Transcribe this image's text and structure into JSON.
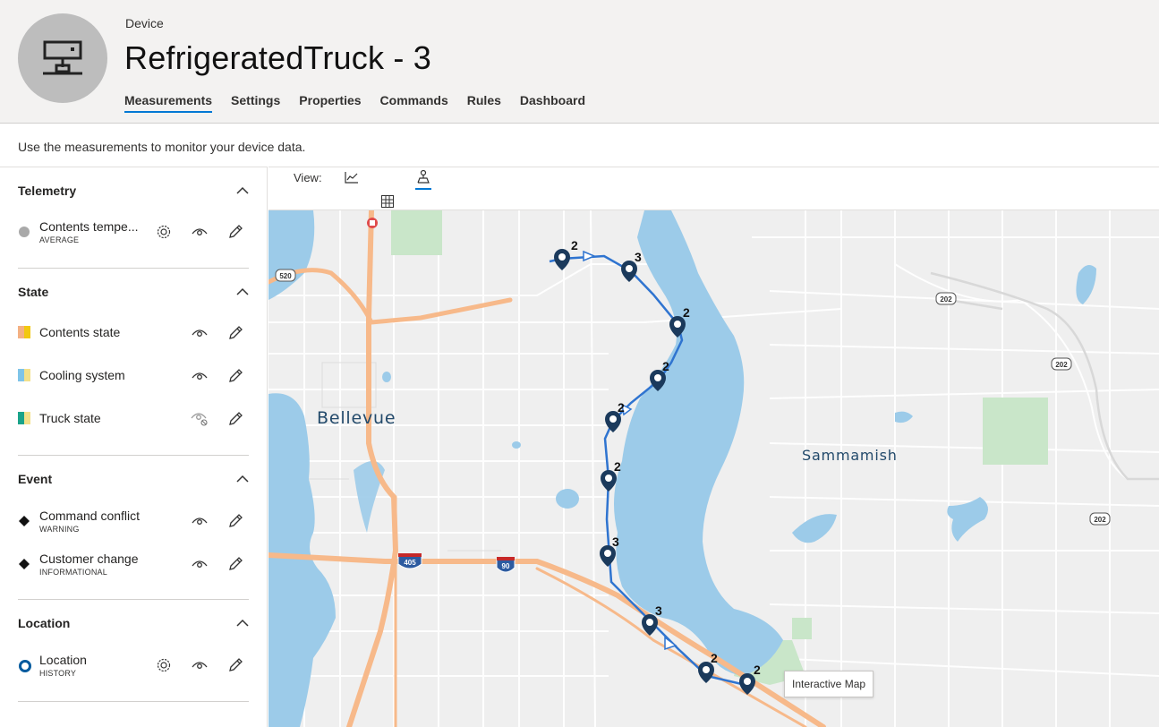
{
  "header": {
    "kicker": "Device",
    "title": "RefrigeratedTruck - 3",
    "avatar_icon": "device-icon",
    "tabs": [
      {
        "label": "Measurements",
        "active": true
      },
      {
        "label": "Settings",
        "active": false
      },
      {
        "label": "Properties",
        "active": false
      },
      {
        "label": "Commands",
        "active": false
      },
      {
        "label": "Rules",
        "active": false
      },
      {
        "label": "Dashboard",
        "active": false
      }
    ]
  },
  "subtitle": "Use the measurements to monitor your device data.",
  "sections": {
    "telemetry": {
      "title": "Telemetry",
      "items": [
        {
          "label": "Contents tempe...",
          "sub": "AVERAGE",
          "color": "#a9a9a9"
        }
      ]
    },
    "state": {
      "title": "State",
      "items": [
        {
          "label": "Contents state",
          "colors": [
            "#f4b183",
            "#f2c811"
          ]
        },
        {
          "label": "Cooling system",
          "colors": [
            "#7fc4e8",
            "#f3e08a"
          ]
        },
        {
          "label": "Truck state",
          "colors": [
            "#1aa38a",
            "#f3e08a"
          ]
        }
      ]
    },
    "event": {
      "title": "Event",
      "items": [
        {
          "label": "Command conflict",
          "sub": "WARNING"
        },
        {
          "label": "Customer change",
          "sub": "INFORMATIONAL"
        }
      ]
    },
    "location": {
      "title": "Location",
      "items": [
        {
          "label": "Location",
          "sub": "HISTORY",
          "color": "#005a9e"
        }
      ]
    }
  },
  "view": {
    "label": "View:",
    "buttons": [
      "chart-icon",
      "map-icon",
      "grid-icon"
    ],
    "active": "map-icon"
  },
  "map": {
    "city_labels": [
      "Bellevue",
      "Sammamish"
    ],
    "highway_shields": [
      "520",
      "405",
      "90",
      "202",
      "202",
      "202"
    ],
    "pins": [
      {
        "count": "2"
      },
      {
        "count": "3"
      },
      {
        "count": "2"
      },
      {
        "count": "2"
      },
      {
        "count": "2"
      },
      {
        "count": "2"
      },
      {
        "count": "3"
      },
      {
        "count": "3"
      },
      {
        "count": "2"
      },
      {
        "count": "2"
      }
    ],
    "tooltip": "Interactive Map",
    "colors": {
      "water": "#9ccbe9",
      "route": "#2f74d0",
      "park": "#c9e6c9",
      "highway": "#f7b98a",
      "pin": "#1b3a5c"
    }
  }
}
